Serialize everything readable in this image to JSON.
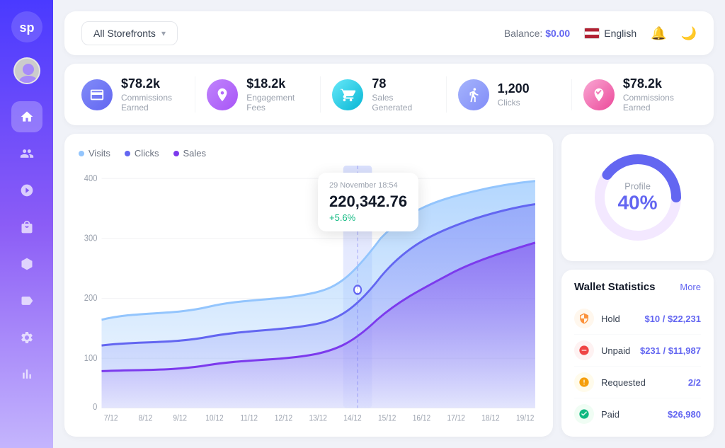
{
  "sidebar": {
    "logo_text": "sp",
    "nav_items": [
      {
        "id": "home",
        "icon": "⊞",
        "active": true
      },
      {
        "id": "users",
        "icon": "👥",
        "active": false
      },
      {
        "id": "design",
        "icon": "🎨",
        "active": false
      },
      {
        "id": "bag",
        "icon": "👜",
        "active": false
      },
      {
        "id": "cube",
        "icon": "📦",
        "active": false
      },
      {
        "id": "tag",
        "icon": "🏷️",
        "active": false
      },
      {
        "id": "settings",
        "icon": "⚙️",
        "active": false
      },
      {
        "id": "analytics",
        "icon": "📊",
        "active": false
      }
    ]
  },
  "header": {
    "storefront_label": "All Storefronts",
    "balance_label": "Balance:",
    "balance_value": "$0.00",
    "language": "English",
    "chevron": "▾"
  },
  "stats": [
    {
      "icon": "💳",
      "icon_class": "blue",
      "value": "$78.2k",
      "label": "Commissions Earned"
    },
    {
      "icon": "🎯",
      "icon_class": "purple",
      "value": "$18.2k",
      "label": "Engagement Fees"
    },
    {
      "icon": "🛒",
      "icon_class": "teal",
      "value": "78",
      "label": "Sales Generated"
    },
    {
      "icon": "🔔",
      "icon_class": "indigo",
      "value": "1,200",
      "label": "Clicks"
    },
    {
      "icon": "🌸",
      "icon_class": "pink",
      "value": "$78.2k",
      "label": "Commissions Earned"
    }
  ],
  "chart": {
    "legend": [
      {
        "label": "Visits",
        "color": "#93c5fd"
      },
      {
        "label": "Clicks",
        "color": "#6366f1"
      },
      {
        "label": "Sales",
        "color": "#7c3aed"
      }
    ],
    "x_labels": [
      "7/12",
      "8/12",
      "9/12",
      "10/12",
      "11/12",
      "12/12",
      "13/12",
      "14/12",
      "15/12",
      "16/12",
      "17/12",
      "18/12",
      "19/12"
    ],
    "y_labels": [
      "0",
      "100",
      "200",
      "300",
      "400"
    ],
    "tooltip": {
      "date": "29 November 18:54",
      "value": "220,342.76",
      "change": "+5.6%"
    }
  },
  "profile": {
    "label": "Profile",
    "percent": "40%",
    "percent_num": 40
  },
  "wallet": {
    "title": "Wallet Statistics",
    "more_label": "More",
    "rows": [
      {
        "icon": "🟠",
        "icon_color": "#fb923c",
        "label": "Hold",
        "value": "$10 / $22,231"
      },
      {
        "icon": "⛔",
        "icon_color": "#ef4444",
        "label": "Unpaid",
        "value": "$231 / $11,987"
      },
      {
        "icon": "❓",
        "icon_color": "#f59e0b",
        "label": "Requested",
        "value": "2/2"
      },
      {
        "icon": "✅",
        "icon_color": "#10b981",
        "label": "Paid",
        "value": "$26,980"
      }
    ]
  }
}
